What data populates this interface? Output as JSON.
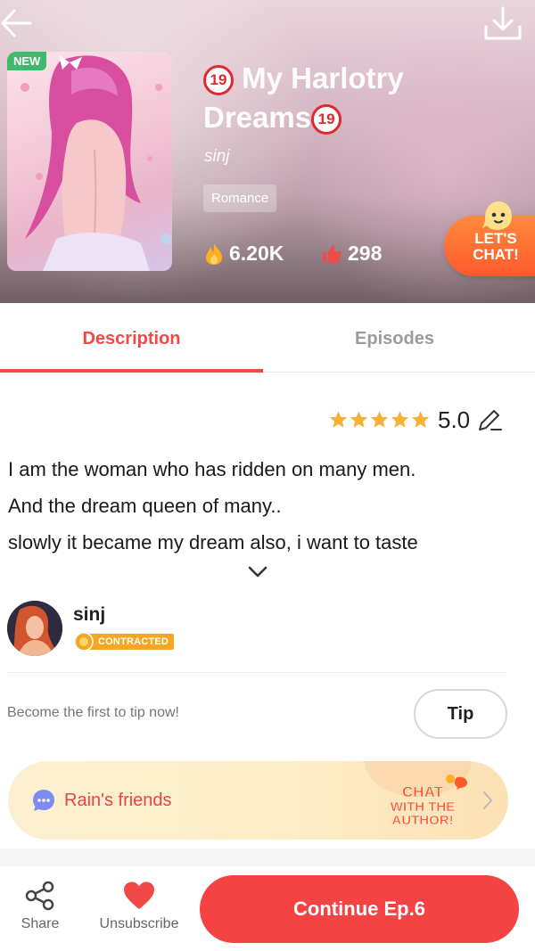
{
  "header": {
    "cover_badge": "NEW",
    "age_rating": "19",
    "title": "My Harlotry Dreams",
    "author": "sinj",
    "genre": "Romance",
    "views": "6.20K",
    "likes": "298",
    "chat_button": "LET'S CHAT!",
    "icons": [
      "back-arrow-icon",
      "download-icon",
      "flame-icon",
      "thumbs-up-icon"
    ]
  },
  "tabs": [
    {
      "label": "Description",
      "active": true
    },
    {
      "label": "Episodes",
      "active": false
    }
  ],
  "rating": {
    "value": "5.0",
    "stars": 5
  },
  "description": {
    "lines": [
      "I am the woman who has ridden on many men.",
      "And the dream queen of many..",
      "slowly it became my dream also, i want to taste"
    ]
  },
  "author_card": {
    "name": "sinj",
    "badge": "CONTRACTED"
  },
  "tip": {
    "prompt": "Become the first to tip now!",
    "button": "Tip"
  },
  "friends": {
    "label": "Rain's friends",
    "chat_line1": "CHAT",
    "chat_line2": "WITH THE",
    "chat_line3": "AUTHOR!"
  },
  "bottom_bar": {
    "share": "Share",
    "unsubscribe": "Unsubscribe",
    "continue": "Continue Ep.6"
  },
  "colors": {
    "accent": "#f24848",
    "continue_button": "#f54242",
    "chat_orange": "#ff5a2a",
    "star": "#f5b133",
    "badge_green": "#3dbb6b"
  }
}
